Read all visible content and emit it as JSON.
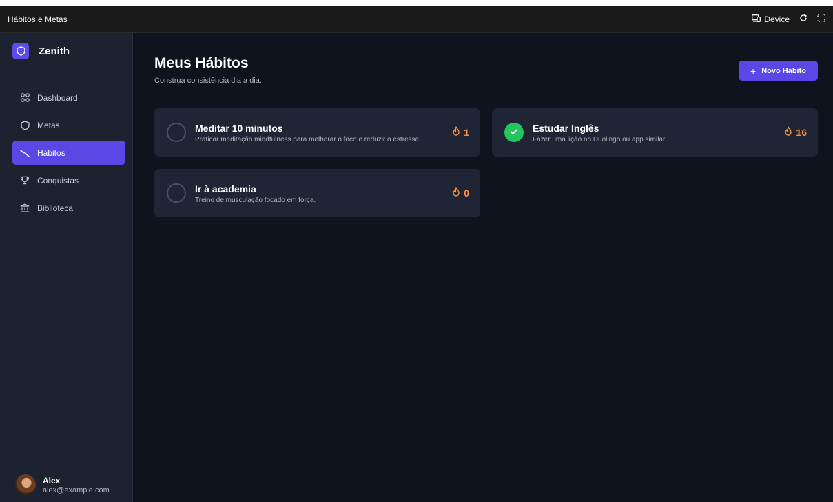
{
  "window": {
    "title": "Hábitos e Metas",
    "device_label": "Device"
  },
  "brand": {
    "name": "Zenith",
    "color": "#5b4be7"
  },
  "sidebar": {
    "items": [
      {
        "label": "Dashboard",
        "icon": "dashboard-grid-icon",
        "active": false
      },
      {
        "label": "Metas",
        "icon": "shield-icon",
        "active": false
      },
      {
        "label": "Hábitos",
        "icon": "trend-line-icon",
        "active": true
      },
      {
        "label": "Conquistas",
        "icon": "trophy-icon",
        "active": false
      },
      {
        "label": "Biblioteca",
        "icon": "library-icon",
        "active": false
      }
    ]
  },
  "user": {
    "name": "Alex",
    "email": "alex@example.com"
  },
  "page": {
    "title": "Meus Hábitos",
    "subtitle": "Construa consistência dia a dia."
  },
  "actions": {
    "new_habit_label": "Novo Hábito",
    "new_habit_icon": "+"
  },
  "habits": [
    {
      "title": "Meditar 10 minutos",
      "description": "Praticar meditação mindfulness para melhorar o foco e reduzir o estresse.",
      "streak": "1",
      "completed": false
    },
    {
      "title": "Estudar Inglês",
      "description": "Fazer uma lição no Duolingo ou app similar.",
      "streak": "16",
      "completed": true
    },
    {
      "title": "Ir à academia",
      "description": "Treino de musculação focado em força.",
      "streak": "0",
      "completed": false
    }
  ],
  "colors": {
    "accent": "#5a48e6",
    "success": "#22c55e",
    "streak": "#fb923c",
    "background": "#0f131d"
  }
}
